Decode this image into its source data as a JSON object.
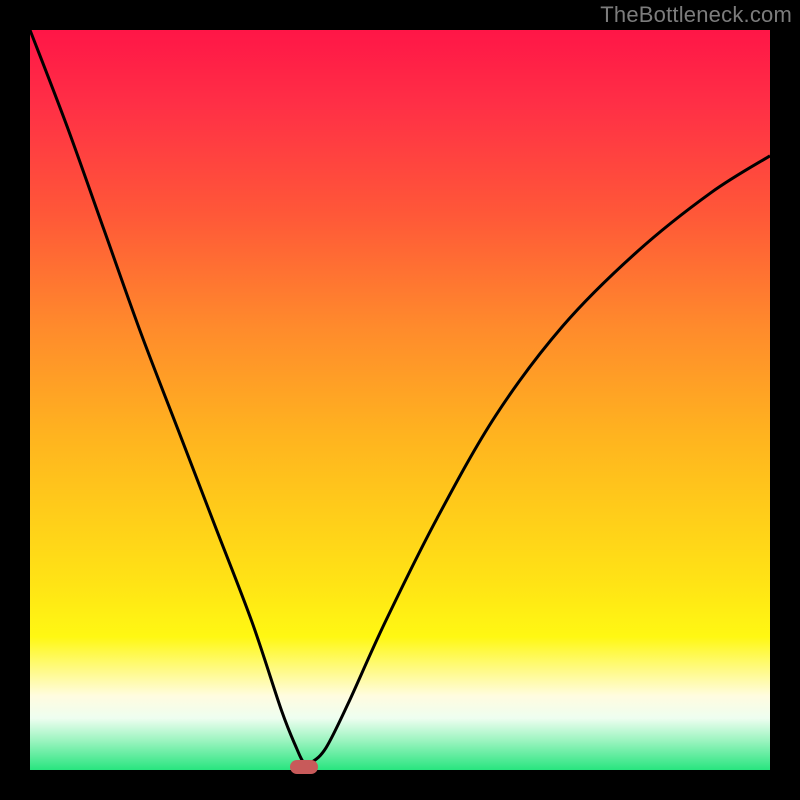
{
  "watermark": "TheBottleneck.com",
  "chart_data": {
    "type": "line",
    "title": "",
    "xlabel": "",
    "ylabel": "",
    "xlim": [
      0,
      100
    ],
    "ylim": [
      0,
      100
    ],
    "series": [
      {
        "name": "bottleneck-curve",
        "x": [
          0,
          5,
          10,
          15,
          20,
          25,
          30,
          34,
          36,
          37,
          38,
          40,
          43,
          48,
          55,
          63,
          72,
          82,
          92,
          100
        ],
        "y": [
          100,
          87,
          73,
          59,
          46,
          33,
          20,
          8,
          3,
          1,
          1,
          3,
          9,
          20,
          34,
          48,
          60,
          70,
          78,
          83
        ]
      }
    ],
    "optimum_marker": {
      "x": 37,
      "y": 0
    },
    "grid": false,
    "legend": false
  },
  "colors": {
    "background_black": "#000000",
    "curve": "#000000",
    "marker": "#c85a5a",
    "watermark": "#7c7c7c"
  }
}
